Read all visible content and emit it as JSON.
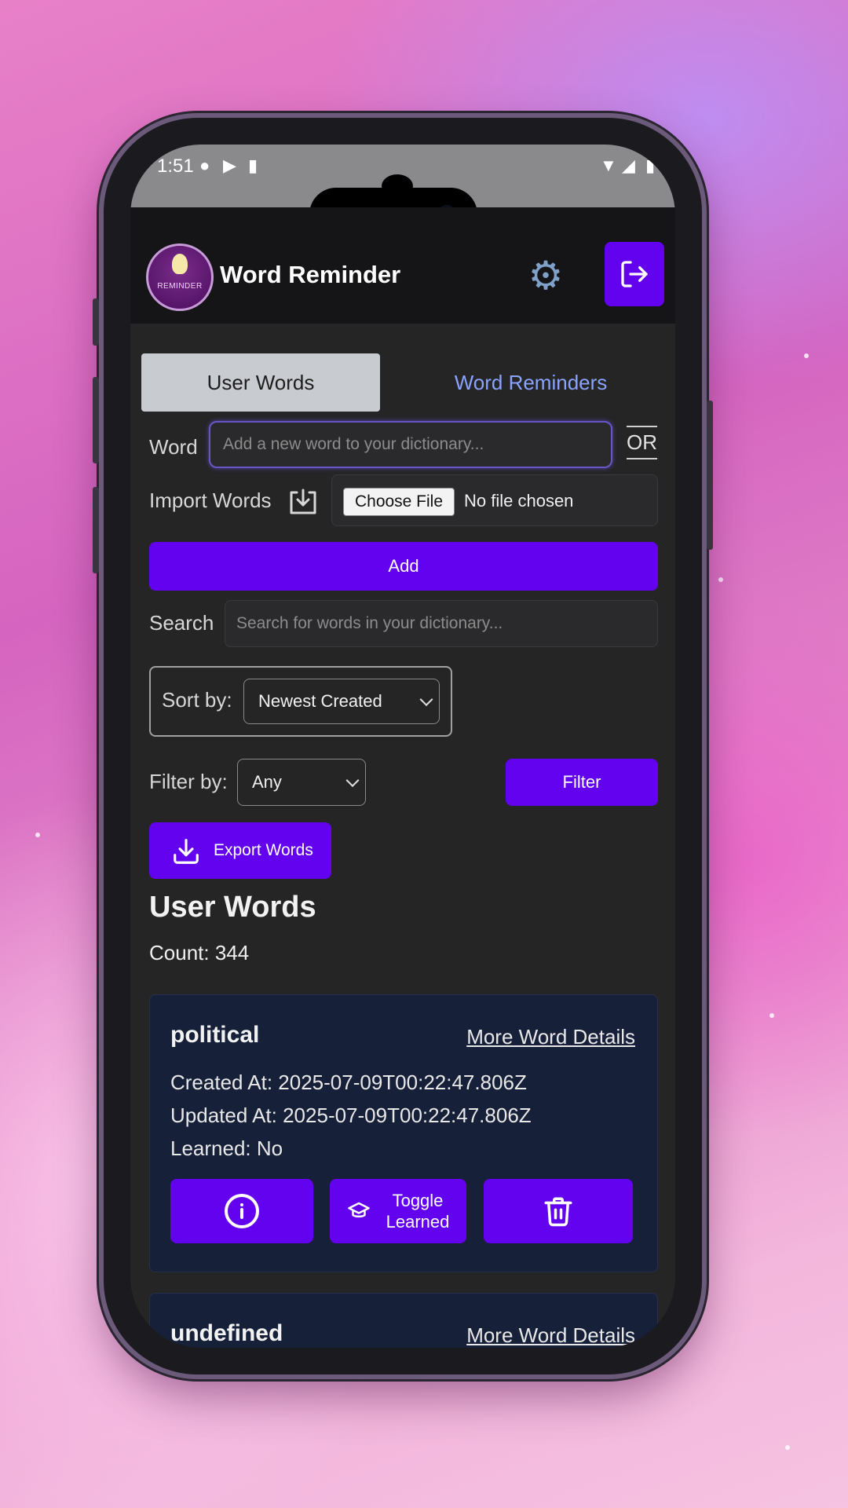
{
  "status_bar": {
    "time": "1:51"
  },
  "header": {
    "app_title": "Word Reminder",
    "logo_text": "REMINDER"
  },
  "tabs": [
    {
      "label": "User Words",
      "active": true
    },
    {
      "label": "Word Reminders",
      "active": false
    }
  ],
  "form": {
    "word_label": "Word",
    "word_placeholder": "Add a new word to your dictionary...",
    "or_label": "OR",
    "import_label": "Import Words",
    "choose_file_label": "Choose File",
    "no_file_text": "No file chosen",
    "add_label": "Add",
    "search_label": "Search",
    "search_placeholder": "Search for words in your dictionary...",
    "sort_label": "Sort by:",
    "sort_value": "Newest Created",
    "filter_label": "Filter by:",
    "filter_value": "Any",
    "filter_button": "Filter",
    "export_label": "Export Words"
  },
  "list": {
    "title": "User Words",
    "count_text": "Count: 344",
    "items": [
      {
        "word": "political",
        "details_link": "More Word Details",
        "created": "Created At: 2025-07-09T00:22:47.806Z",
        "updated": "Updated At: 2025-07-09T00:22:47.806Z",
        "learned": "Learned: No",
        "toggle_line1": "Toggle",
        "toggle_line2": "Learned"
      },
      {
        "word": "undefined",
        "details_link": "More Word Details"
      }
    ]
  },
  "colors": {
    "accent": "#6202ee",
    "card_bg": "#172039",
    "tab_link": "#8aa3ff"
  }
}
